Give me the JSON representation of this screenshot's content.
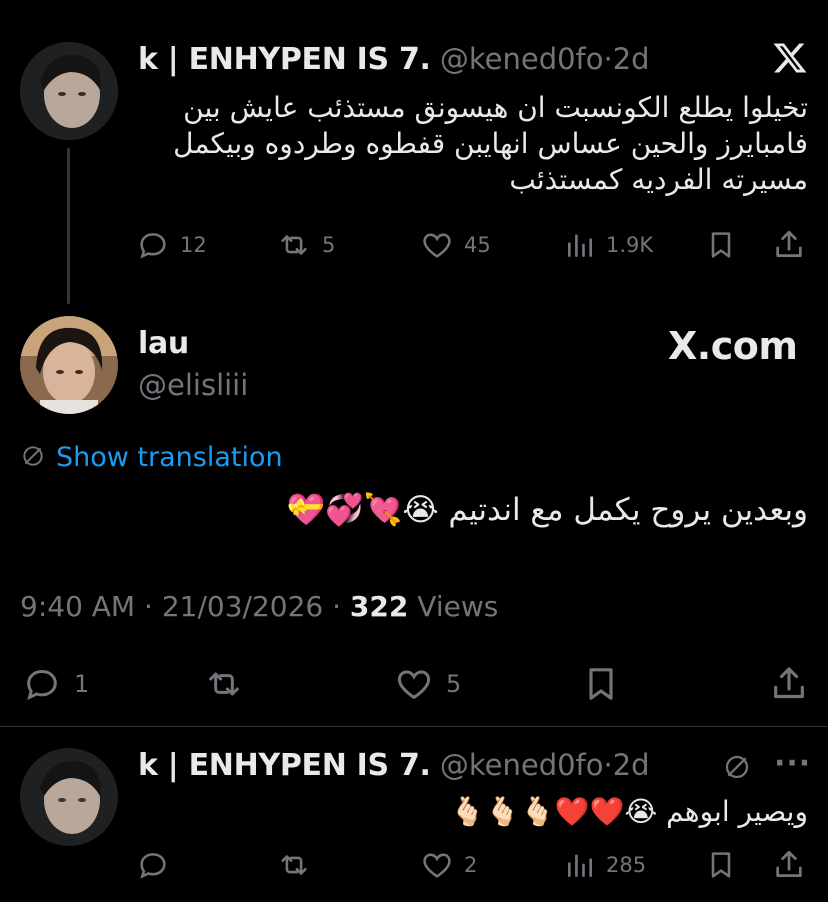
{
  "quoted_tweet": {
    "display_name": "k | ENHYPEN IS 7.",
    "handle": "@kened0fo",
    "time": "2d",
    "text": "تخيلوا يطلع الكونسبت ان هيسونق مستذئب عايش بين فامبايرز والحين عساس انهايبن قفطوه وطردوه وبيكمل مسيرته الفرديه كمستذئب",
    "replies": "12",
    "reposts": "5",
    "likes": "45",
    "views": "1.9K",
    "logo": "X"
  },
  "main_tweet": {
    "display_name": "lau",
    "handle": "@elisliii",
    "site_label": "X.com",
    "translate_label": "Show translation",
    "text": "وبعدين يروح يكمل مع اندتيم 😭💘💞💝",
    "time": "9:40 AM",
    "date": "21/03/2026",
    "views_count": "322",
    "views_label": "Views",
    "replies": "1",
    "likes": "5"
  },
  "reply_tweet": {
    "display_name": "k | ENHYPEN IS 7.",
    "handle": "@kened0fo",
    "time": "2d",
    "more": "···",
    "text": "ويصير ابوهم 😭❤️❤️🫰🏻🫰🏻🫰🏻",
    "likes": "2",
    "views": "285"
  },
  "colors": {
    "background": "#000000",
    "text": "#e7e9ea",
    "muted": "#71767b",
    "link": "#1d9bf0",
    "divider": "#2f3336"
  },
  "icons": [
    "reply-icon",
    "repost-icon",
    "like-icon",
    "views-icon",
    "bookmark-icon",
    "share-icon",
    "x-logo-icon",
    "translate-icon",
    "more-icon"
  ]
}
